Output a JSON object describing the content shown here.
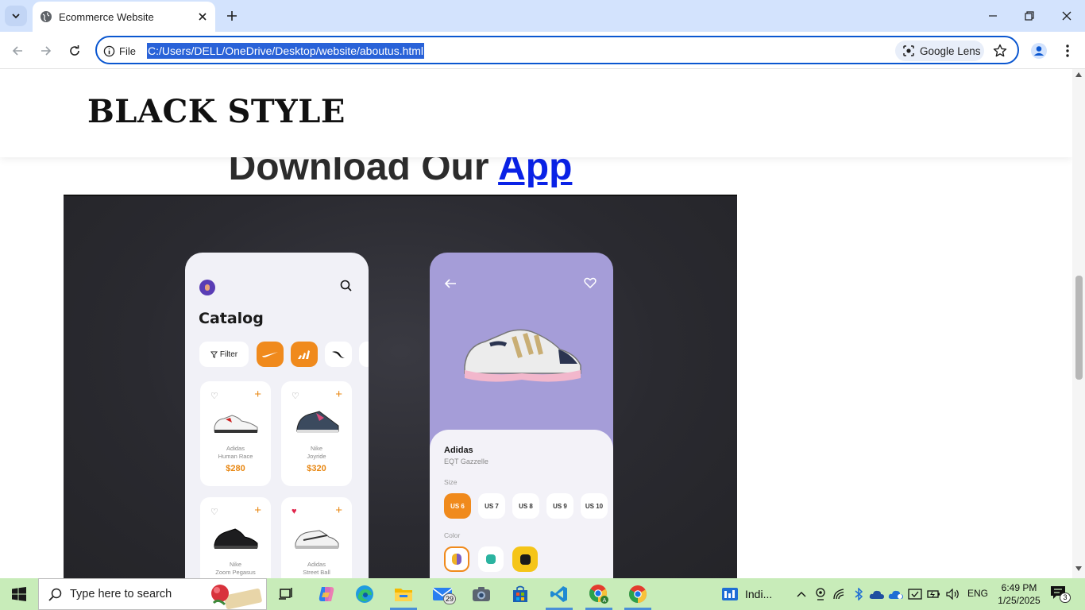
{
  "browser": {
    "tab_title": "Ecommerce Website",
    "site_info_label": "File",
    "url": "C:/Users/DELL/OneDrive/Desktop/website/aboutus.html",
    "lens_label": "Google Lens"
  },
  "page": {
    "brand": "BLACK STYLE",
    "section_title_prefix": "Download Our",
    "section_title_link": "App",
    "phone_catalog": {
      "title": "Catalog",
      "filter_label": "Filter",
      "products": [
        {
          "name_line1": "Adidas",
          "name_line2": "Human Race",
          "price": "$280",
          "liked": false
        },
        {
          "name_line1": "Nike",
          "name_line2": "Joyride",
          "price": "$320",
          "liked": false
        },
        {
          "name_line1": "Nike",
          "name_line2": "Zoom Pegasus",
          "price": "",
          "liked": false
        },
        {
          "name_line1": "Adidas",
          "name_line2": "Street Ball",
          "price": "",
          "liked": true
        }
      ]
    },
    "phone_detail": {
      "brand": "Adidas",
      "model": "EQT Gazzelle",
      "size_label": "Size",
      "sizes": [
        "US 6",
        "US 7",
        "US 8",
        "US 9",
        "US 10"
      ],
      "selected_size": "US 6",
      "color_label": "Color",
      "colors": [
        "#7b5cc2",
        "#2bb3a0",
        "#1a1a1a"
      ]
    },
    "accent_color": "#f08a1c",
    "link_color": "#0a22e6"
  },
  "taskbar": {
    "search_placeholder": "Type here to search",
    "mail_badge": "29",
    "widget_label": "Indi...",
    "language": "ENG",
    "time": "6:49 PM",
    "date": "1/25/2025",
    "notification_count": "3"
  }
}
